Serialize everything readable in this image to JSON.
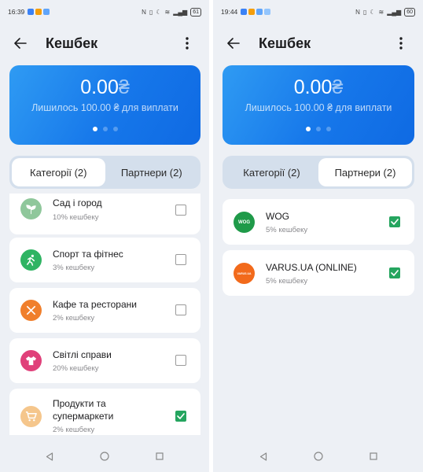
{
  "left": {
    "status": {
      "time": "16:39",
      "battery": "61"
    },
    "title": "Кешбек",
    "balance": {
      "amount": "0.00",
      "currency": "₴",
      "remaining": "Лишилось 100.00 ₴ для виплати"
    },
    "tabs": [
      {
        "label": "Категорії (2)"
      },
      {
        "label": "Партнери (2)"
      }
    ],
    "active_tab": 0,
    "items": [
      {
        "title": "Сад і город",
        "subtitle": "10% кешбеку",
        "icon": "sprout-icon",
        "color": "#8fc79b",
        "checked": false
      },
      {
        "title": "Спорт та фітнес",
        "subtitle": "3% кешбеку",
        "icon": "running-person-icon",
        "color": "#2fb463",
        "checked": false
      },
      {
        "title": "Кафе та ресторани",
        "subtitle": "2% кешбеку",
        "icon": "cutlery-icon",
        "color": "#f07f2c",
        "checked": false
      },
      {
        "title": "Світлі справи",
        "subtitle": "20% кешбеку",
        "icon": "tshirt-icon",
        "color": "#e0407a",
        "checked": false
      },
      {
        "title": "Продукти та супермаркети",
        "subtitle": "2% кешбеку",
        "icon": "shopping-cart-icon",
        "color": "#f5c68c",
        "checked": true
      }
    ]
  },
  "right": {
    "status": {
      "time": "19:44",
      "battery": "60"
    },
    "title": "Кешбек",
    "balance": {
      "amount": "0.00",
      "currency": "₴",
      "remaining": "Лишилось 100.00 ₴ для виплати"
    },
    "tabs": [
      {
        "label": "Категорії (2)"
      },
      {
        "label": "Партнери (2)"
      }
    ],
    "active_tab": 1,
    "items": [
      {
        "title": "WOG",
        "subtitle": "5% кешбеку",
        "icon": "wog-logo",
        "logo_text": "WOG",
        "color": "#1f9a49",
        "checked": true
      },
      {
        "title": "VARUS.UA (ONLINE)",
        "subtitle": "5% кешбеку",
        "icon": "varus-logo",
        "logo_text": "VARUS.UA",
        "color": "#f26a1b",
        "checked": true
      }
    ]
  },
  "colors": {
    "accent": "#1677ea",
    "check": "#25a55f"
  }
}
